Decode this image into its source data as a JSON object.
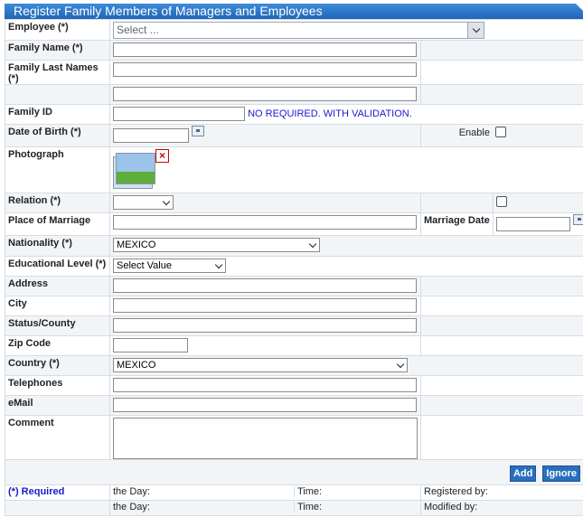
{
  "title": "Register Family Members of Managers and Employees",
  "labels": {
    "employee": "Employee (*)",
    "family_name": "Family Name (*)",
    "family_last_names": "Family Last Names (*)",
    "family_id": "Family ID",
    "date_of_birth": "Date of Birth (*)",
    "enable": "Enable",
    "photograph": "Photograph",
    "relation": "Relation (*)",
    "place_of_marriage": "Place of Marriage",
    "marriage_date": "Marriage Date",
    "nationality": "Nationality (*)",
    "educational_level": "Educational Level (*)",
    "address": "Address",
    "city": "City",
    "status_county": "Status/County",
    "zip_code": "Zip Code",
    "country": "Country (*)",
    "telephones": "Telephones",
    "email": "eMail",
    "comment": "Comment"
  },
  "employee_placeholder": "Select ...",
  "family_id_note": "NO REQUIRED. WITH VALIDATION.",
  "nationality_value": "MEXICO",
  "educational_level_value": "Select Value",
  "country_value": "MEXICO",
  "buttons": {
    "add": "Add",
    "ignore": "Ignore"
  },
  "footer": {
    "required_note": "(*) Required",
    "the_day": "the Day:",
    "time": "Time:",
    "registered_by": "Registered by:",
    "modified_by": "Modified by:"
  },
  "colors": {
    "header": "#2a73c4",
    "note": "#1a1acc"
  }
}
